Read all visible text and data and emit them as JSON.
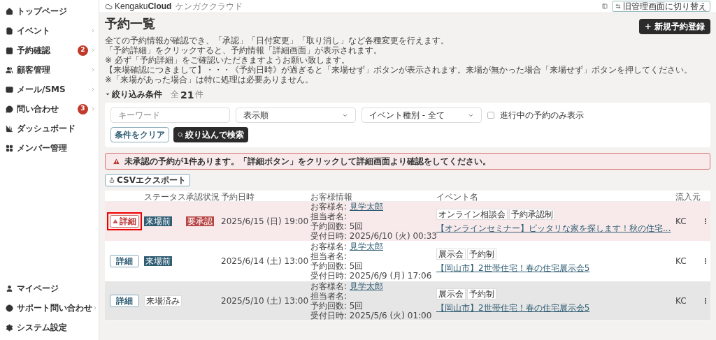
{
  "sidebar": {
    "items": [
      {
        "label": "トップページ",
        "has_submenu": false
      },
      {
        "label": "イベント",
        "has_submenu": true
      },
      {
        "label": "予約確認",
        "badge": "2",
        "has_submenu": true
      },
      {
        "label": "顧客管理",
        "has_submenu": true
      },
      {
        "label": "メール/SMS",
        "has_submenu": true
      },
      {
        "label": "問い合わせ",
        "badge": "3",
        "has_submenu": true
      },
      {
        "label": "ダッシュボード",
        "has_submenu": false
      },
      {
        "label": "メンバー管理",
        "has_submenu": false
      }
    ],
    "bottom_items": [
      {
        "label": "マイページ",
        "has_submenu": false
      },
      {
        "label": "サポート問い合わせ",
        "has_submenu": true
      },
      {
        "label": "システム設定",
        "has_submenu": false
      }
    ]
  },
  "header": {
    "logo": "Kengaku**Cloud**",
    "logo_sub": "ケンガククラウド",
    "switch_button": "旧管理画面に切り替え"
  },
  "page": {
    "title": "予約一覧",
    "new_button": "+ 新規予約登録",
    "description": [
      "全ての予約情報が確認でき、「承認」「日付変更」「取り消し」など各種変更を行えます。",
      "「予約詳細」をクリックすると、予約情報「詳細画面」が表示されます。",
      "※ 必ず「予約詳細」をご確認いただきますようお願い致します。",
      "【来場確認につきまして】・・・《予約日時》が過ぎると「来場せず」ボタンが表示されます。来場が無かった場合「来場せず」ボタンを押してください。",
      "※「来場があった場合」は特に処理は必要ありません。"
    ]
  },
  "filter": {
    "toggle": "絞り込み条件",
    "expanded": true,
    "count_prefix": "全",
    "count": "21",
    "count_suffix": "件",
    "keyword_placeholder": "キーワード",
    "sort_value": "表示順",
    "type_value": "イベント種別 - 全て",
    "in_progress_label": "進行中の予約のみ表示",
    "in_progress_checked": false,
    "clear_button": "条件をクリア",
    "search_button": "絞り込んで検索"
  },
  "alert": "未承認の予約が1件あります。「詳細ボタン」をクリックして詳細画面より確認をしてください。",
  "export_button": "CSVエクスポート",
  "table": {
    "columns": [
      "ステータス",
      "承認状況",
      "予約日時",
      "お客様情報",
      "イベント名",
      "流入元"
    ],
    "rows": [
      {
        "kind": "pending",
        "highlighted": true,
        "detail_button": "詳細",
        "status": {
          "kind": "before",
          "label": "来場前"
        },
        "approval": "要承認",
        "date": "2025/6/15 (日) 19:00",
        "customer_label": "お客様名:",
        "customer": "見学太郎",
        "staff": "担当者名:",
        "visits": "予約回数: 5回",
        "received": "受付日時: 2025/6/10 (火) 00:33",
        "tags": [
          "オンライン相談会",
          "予約承認制"
        ],
        "event": "【オンラインセミナー】ピッタリな家を探します！秋の住宅...",
        "source": "KC"
      },
      {
        "kind": "normal",
        "highlighted": false,
        "detail_button": "詳細",
        "status": {
          "kind": "before",
          "label": "来場前"
        },
        "date": "2025/6/14 (土) 13:00",
        "customer_label": "お客様名:",
        "customer": "見学太郎",
        "staff": "担当者名:",
        "visits": "予約回数: 5回",
        "received": "受付日時: 2025/6/9 (月) 17:06",
        "tags": [
          "展示会",
          "予約制"
        ],
        "event": "【岡山市】2世帯住宅！春の住宅展示会5",
        "source": "KC"
      },
      {
        "kind": "past",
        "highlighted": false,
        "detail_button": "詳細",
        "status": {
          "kind": "visited",
          "label": "来場済み"
        },
        "date": "2025/5/10 (土) 13:00",
        "customer_label": "お客様名:",
        "customer": "見学太郎",
        "staff": "担当者名:",
        "visits": "予約回数: 5回",
        "received": "受付日時: 2025/5/6 (火) 01:00",
        "tags": [
          "展示会",
          "予約制"
        ],
        "event": "【岡山市】2世帯住宅！春の住宅展示会5",
        "source": "KC"
      }
    ]
  }
}
